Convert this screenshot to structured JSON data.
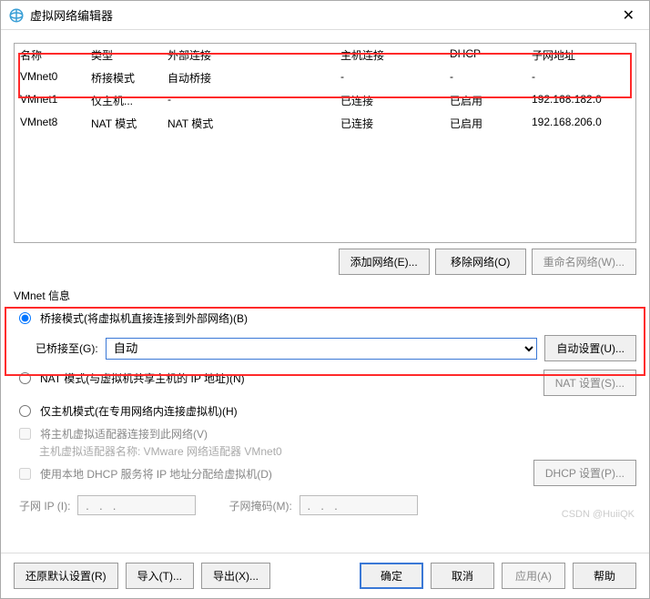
{
  "titlebar": {
    "title": "虚拟网络编辑器"
  },
  "table": {
    "headers": [
      "名称",
      "类型",
      "外部连接",
      "主机连接",
      "DHCP",
      "子网地址"
    ],
    "rows": [
      {
        "name": "VMnet0",
        "type": "桥接模式",
        "ext": "自动桥接",
        "host": "-",
        "dhcp": "-",
        "subnet": "-"
      },
      {
        "name": "VMnet1",
        "type": "仅主机...",
        "ext": "-",
        "host": "已连接",
        "dhcp": "已启用",
        "subnet": "192.168.182.0"
      },
      {
        "name": "VMnet8",
        "type": "NAT 模式",
        "ext": "NAT 模式",
        "host": "已连接",
        "dhcp": "已启用",
        "subnet": "192.168.206.0"
      }
    ]
  },
  "buttons": {
    "add_net": "添加网络(E)...",
    "remove_net": "移除网络(O)",
    "rename_net": "重命名网络(W)...",
    "auto_setting": "自动设置(U)...",
    "nat_setting": "NAT 设置(S)...",
    "dhcp_setting": "DHCP 设置(P)...",
    "restore": "还原默认设置(R)",
    "import": "导入(T)...",
    "export": "导出(X)...",
    "ok": "确定",
    "cancel": "取消",
    "apply": "应用(A)",
    "help": "帮助"
  },
  "group": {
    "title": "VMnet 信息",
    "bridged_label": "桥接模式(将虚拟机直接连接到外部网络)(B)",
    "bridged_to": "已桥接至(G):",
    "bridged_select": "自动",
    "nat_label": "NAT 模式(与虚拟机共享主机的 IP 地址)(N)",
    "hostonly_label": "仅主机模式(在专用网络内连接虚拟机)(H)",
    "host_adapter_chk": "将主机虚拟适配器连接到此网络(V)",
    "host_adapter_name": "主机虚拟适配器名称: VMware 网络适配器 VMnet0",
    "dhcp_chk": "使用本地 DHCP 服务将 IP 地址分配给虚拟机(D)",
    "subnet_ip_label": "子网 IP (I):",
    "subnet_ip_val": " .   .   . ",
    "subnet_mask_label": "子网掩码(M):",
    "subnet_mask_val": " .   .   . "
  },
  "watermark": "CSDN @HuiiQK"
}
